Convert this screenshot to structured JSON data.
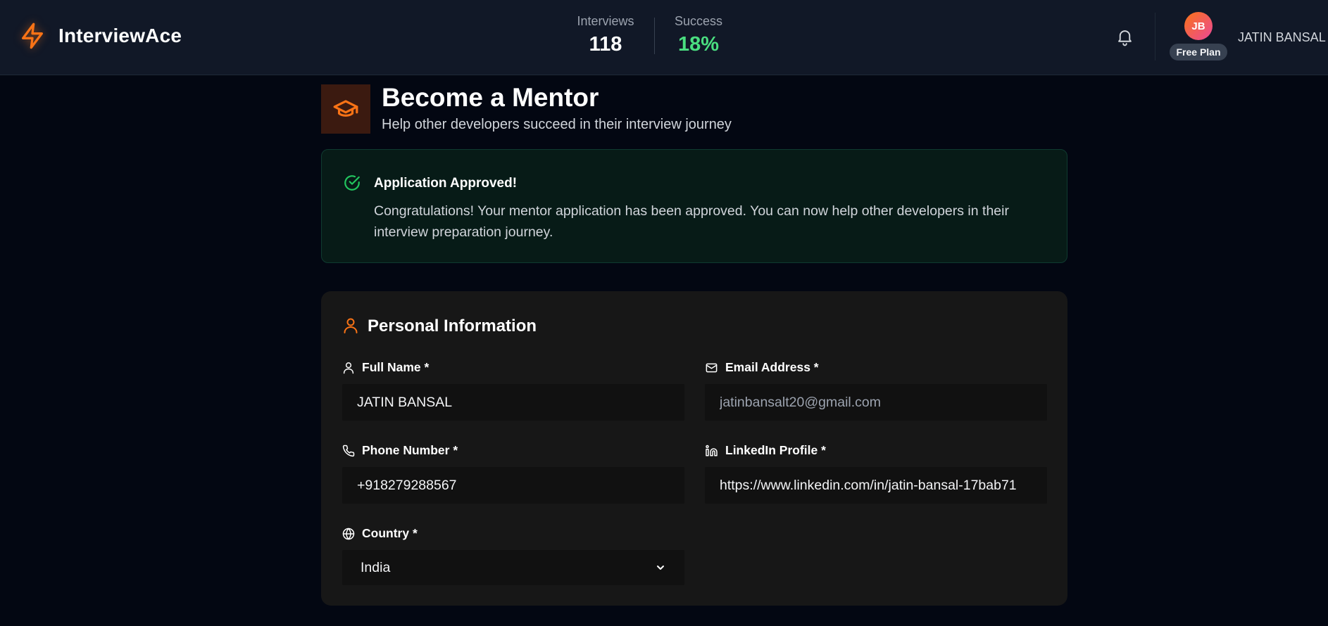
{
  "header": {
    "app_name": "InterviewAce",
    "stats": {
      "interviews_label": "Interviews",
      "interviews_value": "118",
      "success_label": "Success",
      "success_value": "18%"
    },
    "user": {
      "initials": "JB",
      "plan": "Free Plan",
      "name": "JATIN BANSAL"
    },
    "icons": [
      "lightning-icon",
      "bell-icon"
    ]
  },
  "page": {
    "title": "Become a Mentor",
    "subtitle": "Help other developers succeed in their interview journey",
    "title_icon": "graduation-cap-icon"
  },
  "alert": {
    "title": "Application Approved!",
    "message": "Congratulations! Your mentor application has been approved. You can now help other developers in their interview preparation journey.",
    "icon": "check-circle-icon"
  },
  "personal_info": {
    "section_title": "Personal Information",
    "fields": {
      "full_name": {
        "label": "Full Name *",
        "value": "JATIN BANSAL",
        "icon": "user-icon"
      },
      "email": {
        "label": "Email Address *",
        "value": "jatinbansalt20@gmail.com",
        "icon": "mail-icon"
      },
      "phone": {
        "label": "Phone Number *",
        "value": "+918279288567",
        "icon": "phone-icon"
      },
      "linkedin": {
        "label": "LinkedIn Profile *",
        "value": "https://www.linkedin.com/in/jatin-bansal-17bab71",
        "icon": "linkedin-icon"
      },
      "country": {
        "label": "Country *",
        "value": "India",
        "icon": "globe-icon"
      }
    }
  },
  "colors": {
    "accent": "#f97316",
    "success": "#4ade80",
    "header_bg": "#111827",
    "page_bg": "#030712",
    "card_bg": "#171717"
  }
}
